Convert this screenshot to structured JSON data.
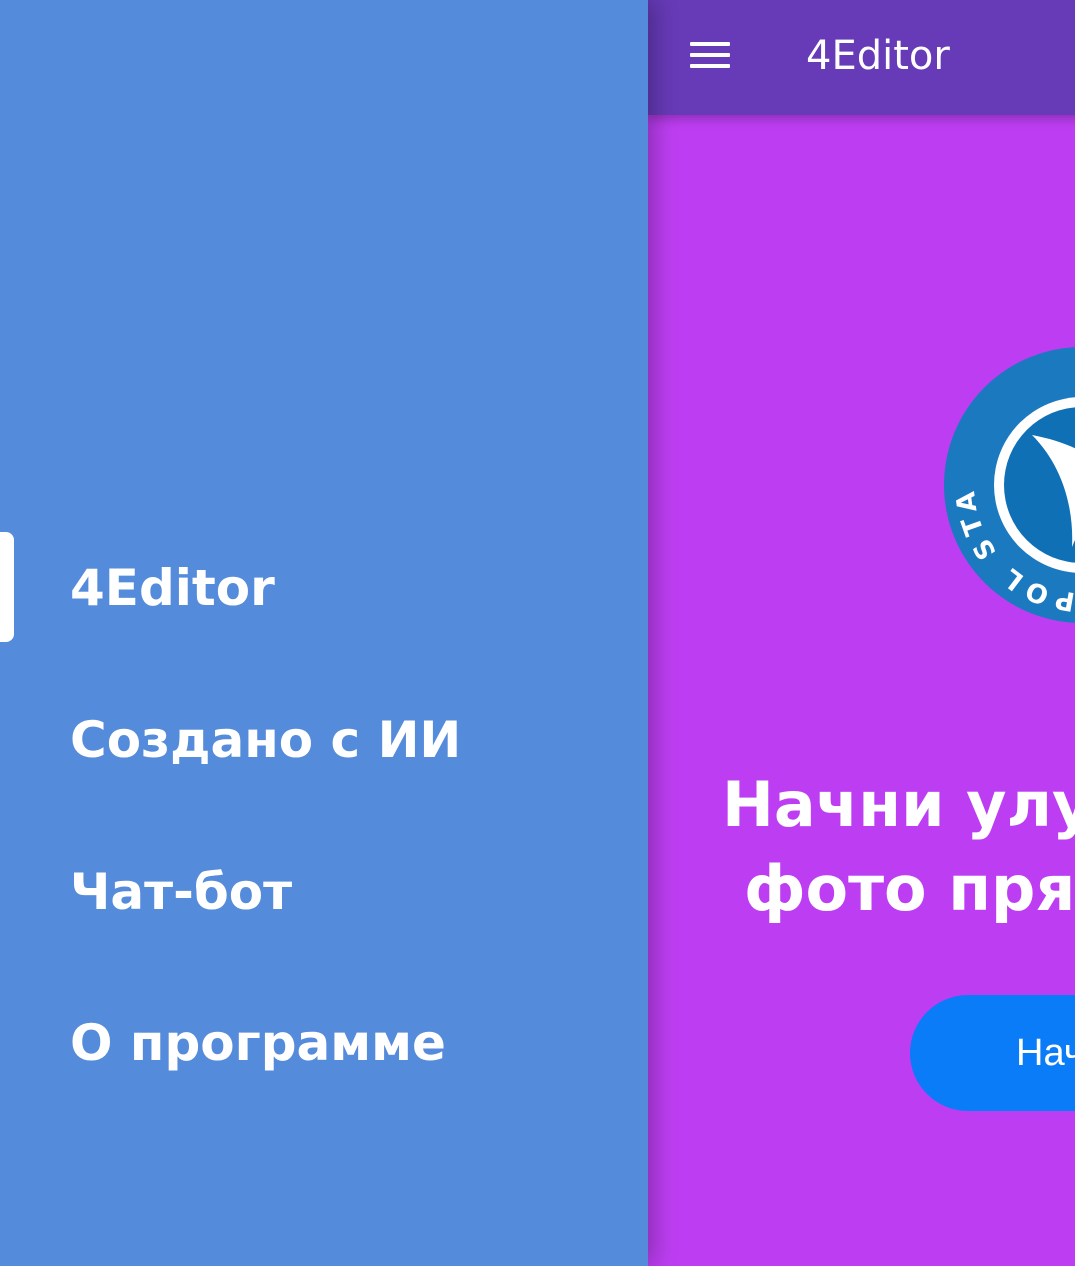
{
  "colors": {
    "drawer_bg": "#548bdb",
    "appbar_bg": "#673ab7",
    "content_bg": "#bd3ef2",
    "button_bg": "#0a7cf8",
    "logo_ring": "#1b79c0",
    "logo_inner": "#0f70b6"
  },
  "drawer": {
    "items": [
      {
        "label": "4Editor",
        "active": true
      },
      {
        "label": "Создано с ИИ",
        "active": false
      },
      {
        "label": "Чат-бот",
        "active": false
      },
      {
        "label": "О программе",
        "active": false
      }
    ]
  },
  "appbar": {
    "menu_icon": "hamburger-menu-icon",
    "title": "4Editor"
  },
  "main": {
    "logo": {
      "icon": "university-seal-icon",
      "ring_text": "SEVASTOPOL STATE UNIVERSITY"
    },
    "headline_line1": "Начни улучшать",
    "headline_line2": "фото прямо сейчас",
    "start_button_label": "Начать"
  }
}
